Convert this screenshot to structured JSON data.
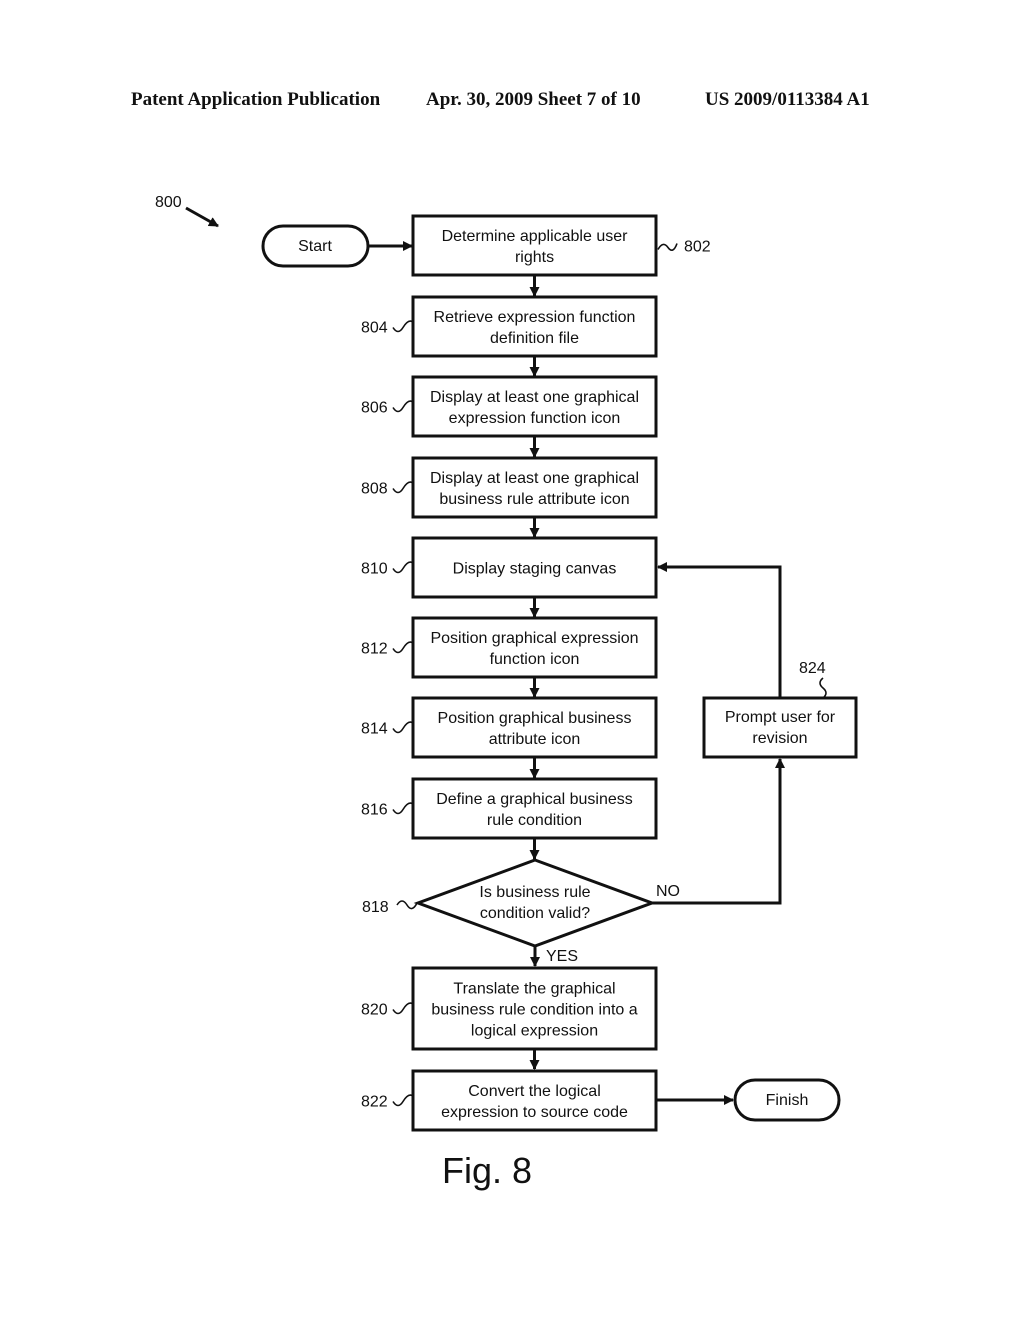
{
  "header": {
    "left": "Patent Application Publication",
    "center": "Apr. 30, 2009  Sheet 7 of 10",
    "right": "US 2009/0113384 A1"
  },
  "figure": {
    "ref": "800",
    "caption": "Fig. 8",
    "start": "Start",
    "finish": "Finish",
    "steps": [
      {
        "ref": "802",
        "lines": [
          "Determine applicable user",
          "rights"
        ]
      },
      {
        "ref": "804",
        "lines": [
          "Retrieve expression function",
          "definition file"
        ]
      },
      {
        "ref": "806",
        "lines": [
          "Display at least one graphical",
          "expression function icon"
        ]
      },
      {
        "ref": "808",
        "lines": [
          "Display at least one graphical",
          "business rule attribute icon"
        ]
      },
      {
        "ref": "810",
        "lines": [
          "Display staging canvas"
        ]
      },
      {
        "ref": "812",
        "lines": [
          "Position graphical expression",
          "function icon"
        ]
      },
      {
        "ref": "814",
        "lines": [
          "Position graphical business",
          "attribute icon"
        ]
      },
      {
        "ref": "816",
        "lines": [
          "Define a graphical business",
          "rule condition"
        ]
      }
    ],
    "decision": {
      "ref": "818",
      "lines": [
        "Is business rule",
        "condition valid?"
      ],
      "yes": "YES",
      "no": "NO"
    },
    "after": [
      {
        "ref": "820",
        "lines": [
          "Translate the graphical",
          "business rule condition into a",
          "logical expression"
        ]
      },
      {
        "ref": "822",
        "lines": [
          "Convert the logical",
          "expression to source code"
        ]
      }
    ],
    "revision": {
      "ref": "824",
      "lines": [
        "Prompt user for",
        "revision"
      ]
    }
  }
}
